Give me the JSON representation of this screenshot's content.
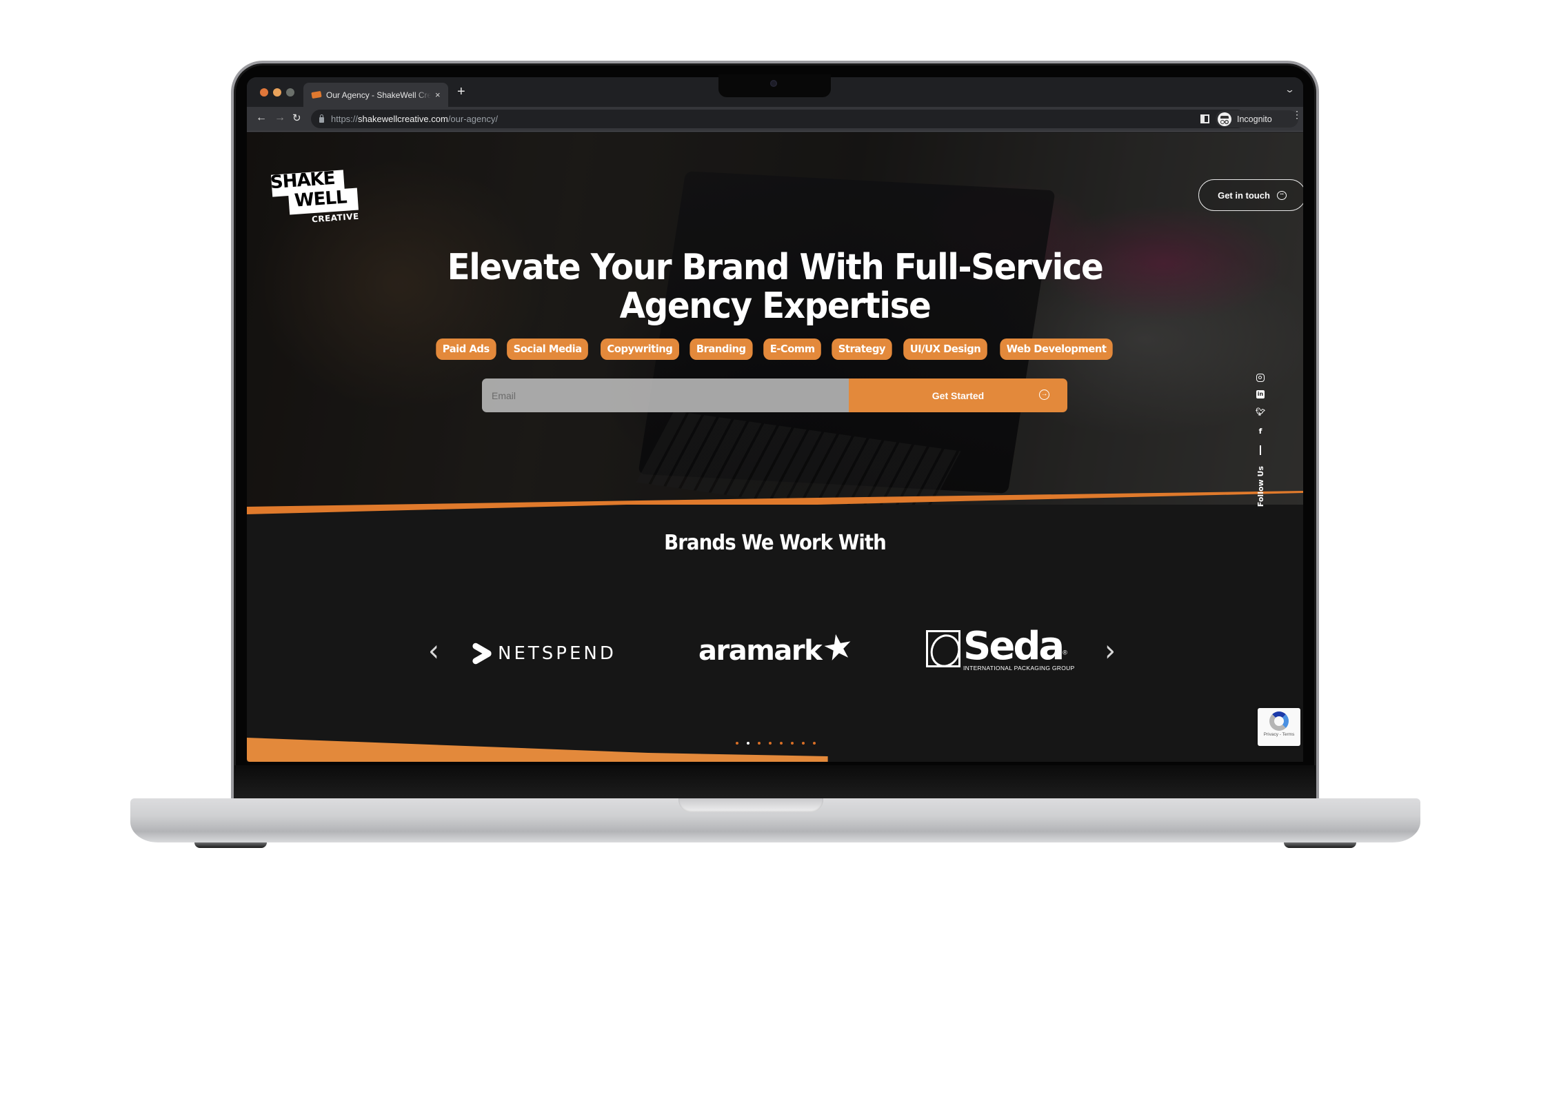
{
  "browser": {
    "tab_title": "Our Agency - ShakeWell Creative",
    "tab_close_glyph": "×",
    "new_tab_glyph": "+",
    "tab_search_glyph": "⌄",
    "nav": {
      "back_glyph": "←",
      "forward_glyph": "→",
      "reload_glyph": "↻"
    },
    "url_scheme": "https://",
    "url_host": "shakewellcreative.com",
    "url_path": "/our-agency/",
    "bookmark_glyph": "★",
    "profile_label": "Incognito",
    "menu_glyph": "⋮"
  },
  "site": {
    "logo": {
      "line1": "SHAKE",
      "line2": "WELL",
      "line3": "CREATIVE"
    },
    "cta_label": "Get in touch",
    "cta_icon_glyph": "···",
    "headline_line1": "Elevate Your Brand With Full-Service",
    "headline_line2": "Agency Expertise",
    "services": [
      "Paid Ads",
      "Social Media",
      "Copywriting",
      "Branding",
      "E-Comm",
      "Strategy",
      "UI/UX Design",
      "Web Development"
    ],
    "email_placeholder": "Email",
    "submit_label": "Get Started",
    "submit_icon_glyph": "→",
    "social": {
      "linkedin_glyph": "in",
      "twitter_glyph": "🐦",
      "facebook_glyph": "f",
      "label": "Follow Us"
    },
    "brands_title": "Brands We Work With",
    "carousel_prev_glyph": "‹",
    "carousel_next_glyph": "›",
    "brands": [
      {
        "name": "NETSPEND"
      },
      {
        "name": "aramark",
        "mark_glyph": "★"
      },
      {
        "name": "Seda",
        "tagline": "INTERNATIONAL PACKAGING GROUP",
        "reg": "®"
      }
    ],
    "carousel": {
      "total_pages": 8,
      "active_page": 2
    },
    "recaptcha_links": "Privacy - Terms"
  },
  "colors": {
    "accent_orange": "#e3893b",
    "page_dark": "#161616",
    "bookmark_blue": "#5b8df0"
  }
}
